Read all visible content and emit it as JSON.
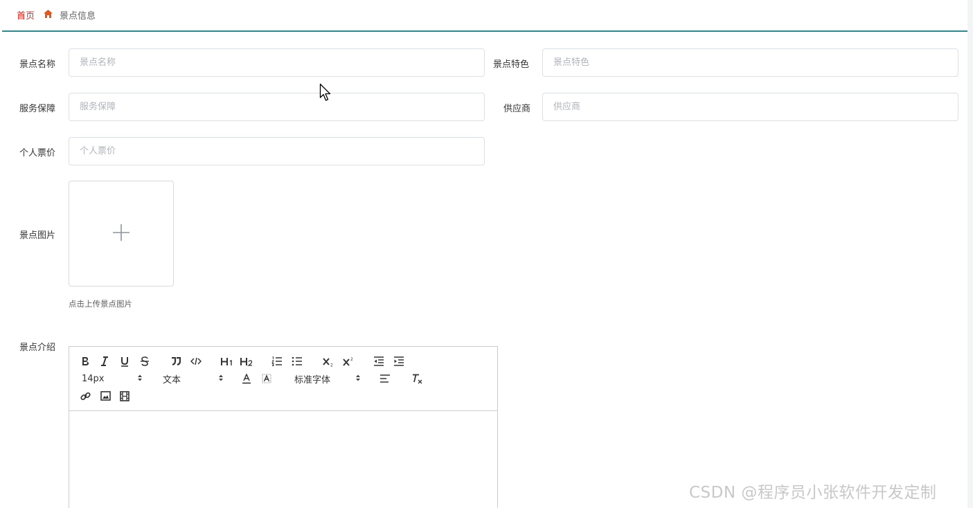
{
  "breadcrumb": {
    "home": "首页",
    "current": "景点信息"
  },
  "form": {
    "name": {
      "label": "景点名称",
      "placeholder": "景点名称"
    },
    "feature": {
      "label": "景点特色",
      "placeholder": "景点特色"
    },
    "service": {
      "label": "服务保障",
      "placeholder": "服务保障"
    },
    "supplier": {
      "label": "供应商",
      "placeholder": "供应商"
    },
    "price": {
      "label": "个人票价",
      "placeholder": "个人票价"
    },
    "image": {
      "label": "景点图片",
      "tip": "点击上传景点图片"
    },
    "intro": {
      "label": "景点介绍"
    }
  },
  "editor": {
    "size_value": "14px",
    "header_value": "文本",
    "font_value": "标准字体",
    "tools_row1": [
      "B",
      "I",
      "U",
      "S",
      "quote",
      "code",
      "H1",
      "H2",
      "ol",
      "ul",
      "sub",
      "sup",
      "outdent",
      "indent"
    ],
    "tools_row3": [
      "link",
      "image",
      "video"
    ]
  },
  "colors": {
    "accent_line": "#2b8a8f",
    "breadcrumb_home": "#d9261c"
  },
  "watermark": "CSDN @程序员小张软件开发定制"
}
